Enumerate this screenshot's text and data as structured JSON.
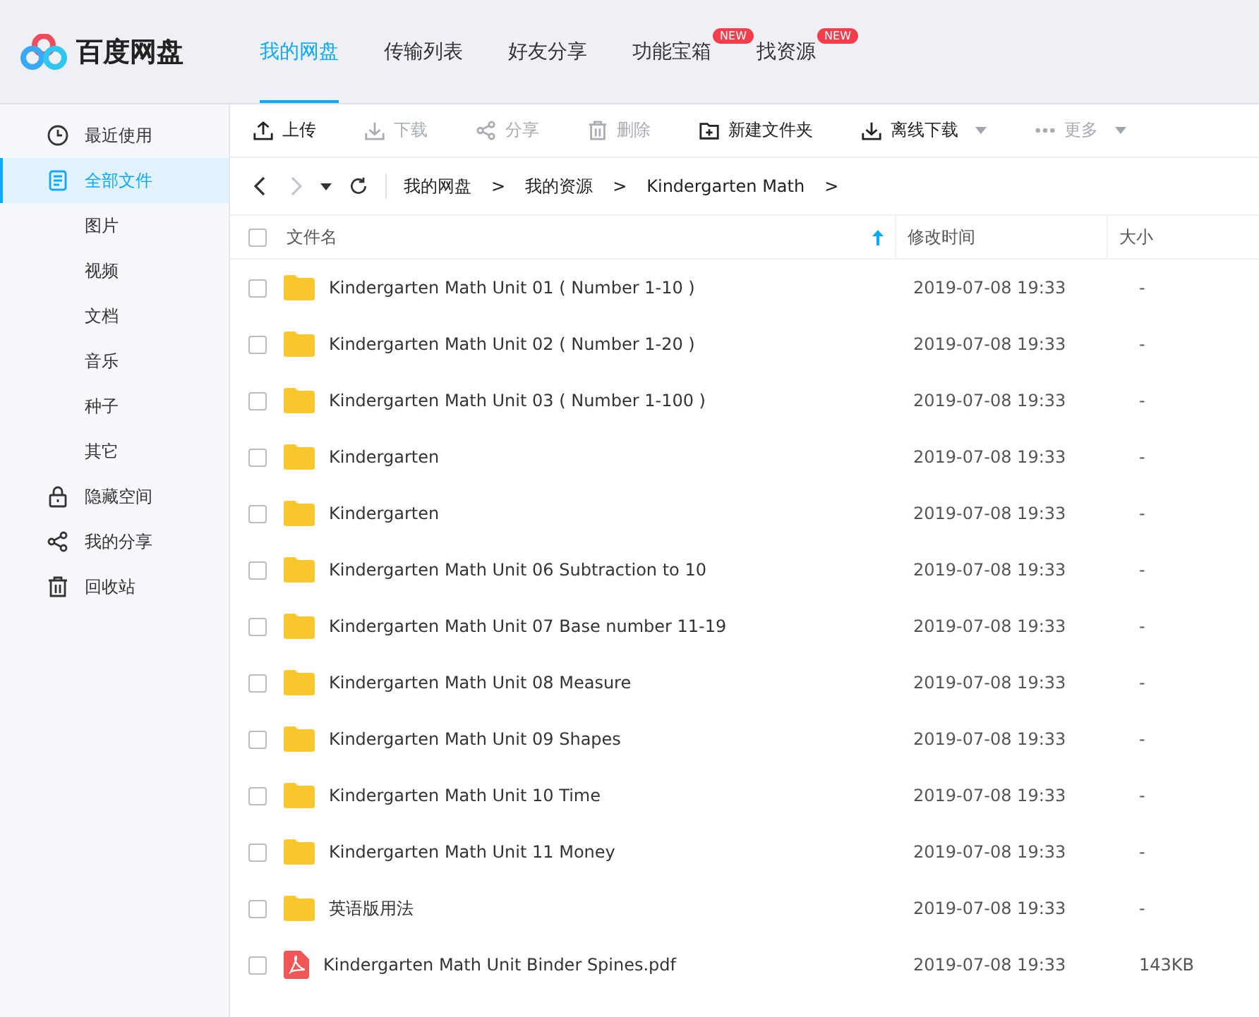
{
  "header": {
    "logo_text": "百度网盘",
    "tabs": [
      {
        "label": "我的网盘",
        "selected": true
      },
      {
        "label": "传输列表",
        "selected": false
      },
      {
        "label": "好友分享",
        "selected": false
      },
      {
        "label": "功能宝箱",
        "selected": false,
        "badge": "NEW"
      },
      {
        "label": "找资源",
        "selected": false,
        "badge": "NEW"
      }
    ]
  },
  "sidebar": {
    "items": [
      {
        "label": "最近使用",
        "kind": "clock",
        "selected": false
      },
      {
        "label": "全部文件",
        "kind": "doc",
        "selected": true,
        "children": [
          {
            "label": "图片",
            "selected": false
          },
          {
            "label": "视频",
            "selected": false
          },
          {
            "label": "文档",
            "selected": false
          },
          {
            "label": "音乐",
            "selected": false
          },
          {
            "label": "种子",
            "selected": false
          },
          {
            "label": "其它",
            "selected": false
          }
        ]
      },
      {
        "label": "隐藏空间",
        "kind": "lock",
        "selected": false
      },
      {
        "label": "我的分享",
        "kind": "share",
        "selected": false
      },
      {
        "label": "回收站",
        "kind": "trash",
        "selected": false
      }
    ]
  },
  "toolbar": [
    {
      "label": "上传",
      "kind": "upload",
      "disabled": false,
      "dropdown": false
    },
    {
      "label": "下载",
      "kind": "download",
      "disabled": true,
      "dropdown": false
    },
    {
      "label": "分享",
      "kind": "share",
      "disabled": true,
      "dropdown": false
    },
    {
      "label": "删除",
      "kind": "trash",
      "disabled": true,
      "dropdown": false
    },
    {
      "label": "新建文件夹",
      "kind": "newfolder",
      "disabled": false,
      "dropdown": false
    },
    {
      "label": "离线下载",
      "kind": "download",
      "disabled": false,
      "dropdown": true
    },
    {
      "label": "更多",
      "kind": "more",
      "disabled": true,
      "dropdown": true
    }
  ],
  "navigation": {
    "forward_disabled": true,
    "breadcrumb": [
      {
        "label": "我的网盘",
        "separator": ">"
      },
      {
        "label": "我的资源",
        "separator": ">"
      },
      {
        "label": "Kindergarten Math",
        "separator": ">"
      }
    ]
  },
  "table": {
    "all_checked": false,
    "columns": [
      {
        "label": "文件名",
        "sorted": true
      },
      {
        "label": "修改时间",
        "sorted": false
      },
      {
        "label": "大小",
        "sorted": false
      }
    ],
    "rows": [
      {
        "kind": "folder",
        "name": "Kindergarten Math Unit 01 ( Number 1-10 )",
        "modified": "2019-07-08 19:33",
        "size": "-",
        "checked": false
      },
      {
        "kind": "folder",
        "name": "Kindergarten Math Unit 02 ( Number 1-20 )",
        "modified": "2019-07-08 19:33",
        "size": "-",
        "checked": false
      },
      {
        "kind": "folder",
        "name": "Kindergarten Math Unit 03 ( Number 1-100 )",
        "modified": "2019-07-08 19:33",
        "size": "-",
        "checked": false
      },
      {
        "kind": "folder",
        "name": "Kindergarten",
        "modified": "2019-07-08 19:33",
        "size": "-",
        "checked": false
      },
      {
        "kind": "folder",
        "name": "Kindergarten",
        "modified": "2019-07-08 19:33",
        "size": "-",
        "checked": false
      },
      {
        "kind": "folder",
        "name": "Kindergarten Math Unit 06 Subtraction to 10",
        "modified": "2019-07-08 19:33",
        "size": "-",
        "checked": false
      },
      {
        "kind": "folder",
        "name": "Kindergarten Math Unit 07 Base number 11-19",
        "modified": "2019-07-08 19:33",
        "size": "-",
        "checked": false
      },
      {
        "kind": "folder",
        "name": "Kindergarten Math Unit 08 Measure",
        "modified": "2019-07-08 19:33",
        "size": "-",
        "checked": false
      },
      {
        "kind": "folder",
        "name": "Kindergarten Math Unit 09 Shapes",
        "modified": "2019-07-08 19:33",
        "size": "-",
        "checked": false
      },
      {
        "kind": "folder",
        "name": "Kindergarten Math Unit 10 Time",
        "modified": "2019-07-08 19:33",
        "size": "-",
        "checked": false
      },
      {
        "kind": "folder",
        "name": "Kindergarten Math Unit 11 Money",
        "modified": "2019-07-08 19:33",
        "size": "-",
        "checked": false
      },
      {
        "kind": "folder",
        "name": "英语版用法",
        "modified": "2019-07-08 19:33",
        "size": "-",
        "checked": false
      },
      {
        "kind": "pdf",
        "name": "Kindergarten Math Unit Binder Spines.pdf",
        "modified": "2019-07-08 19:33",
        "size": "143KB",
        "checked": false
      }
    ]
  }
}
